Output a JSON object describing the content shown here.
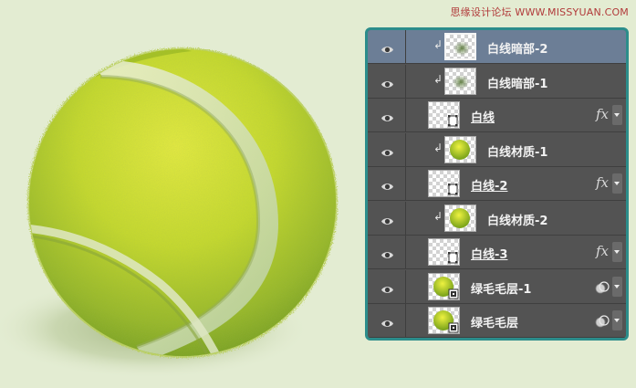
{
  "watermark": "思缘设计论坛 WWW.MISSYUAN.COM",
  "layers": [
    {
      "name": "白线暗部-2",
      "clipped": true,
      "selected": true,
      "thumb": "dark-spot",
      "linked": false,
      "badge": null
    },
    {
      "name": "白线暗部-1",
      "clipped": true,
      "selected": false,
      "thumb": "dark-spot",
      "linked": false,
      "badge": null
    },
    {
      "name": "白线",
      "clipped": false,
      "selected": false,
      "thumb": "shape",
      "linked": true,
      "badge": "fx"
    },
    {
      "name": "白线材质-1",
      "clipped": true,
      "selected": false,
      "thumb": "ball",
      "linked": false,
      "badge": null
    },
    {
      "name": "白线-2",
      "clipped": false,
      "selected": false,
      "thumb": "shape",
      "linked": true,
      "badge": "fx"
    },
    {
      "name": "白线材质-2",
      "clipped": true,
      "selected": false,
      "thumb": "ball",
      "linked": false,
      "badge": null
    },
    {
      "name": "白线-3",
      "clipped": false,
      "selected": false,
      "thumb": "shape",
      "linked": true,
      "badge": "fx"
    },
    {
      "name": "绿毛毛层-1",
      "clipped": false,
      "selected": false,
      "thumb": "ball-smart",
      "linked": false,
      "badge": "mask"
    },
    {
      "name": "绿毛毛层",
      "clipped": false,
      "selected": false,
      "thumb": "ball-smart",
      "linked": false,
      "badge": "mask"
    }
  ],
  "icons": {
    "visibility": "eye-icon",
    "clipping": "clip-arrow-icon",
    "effects": "fx-icon",
    "smart_filter": "smart-filter-icon"
  },
  "colors": {
    "background": "#e3ecd2",
    "panel": "#535353",
    "panel_border": "#2c8d8b",
    "selected_row": "#6c7e96",
    "ball": "#c6dc2c",
    "seam": "#dfe8c4"
  }
}
